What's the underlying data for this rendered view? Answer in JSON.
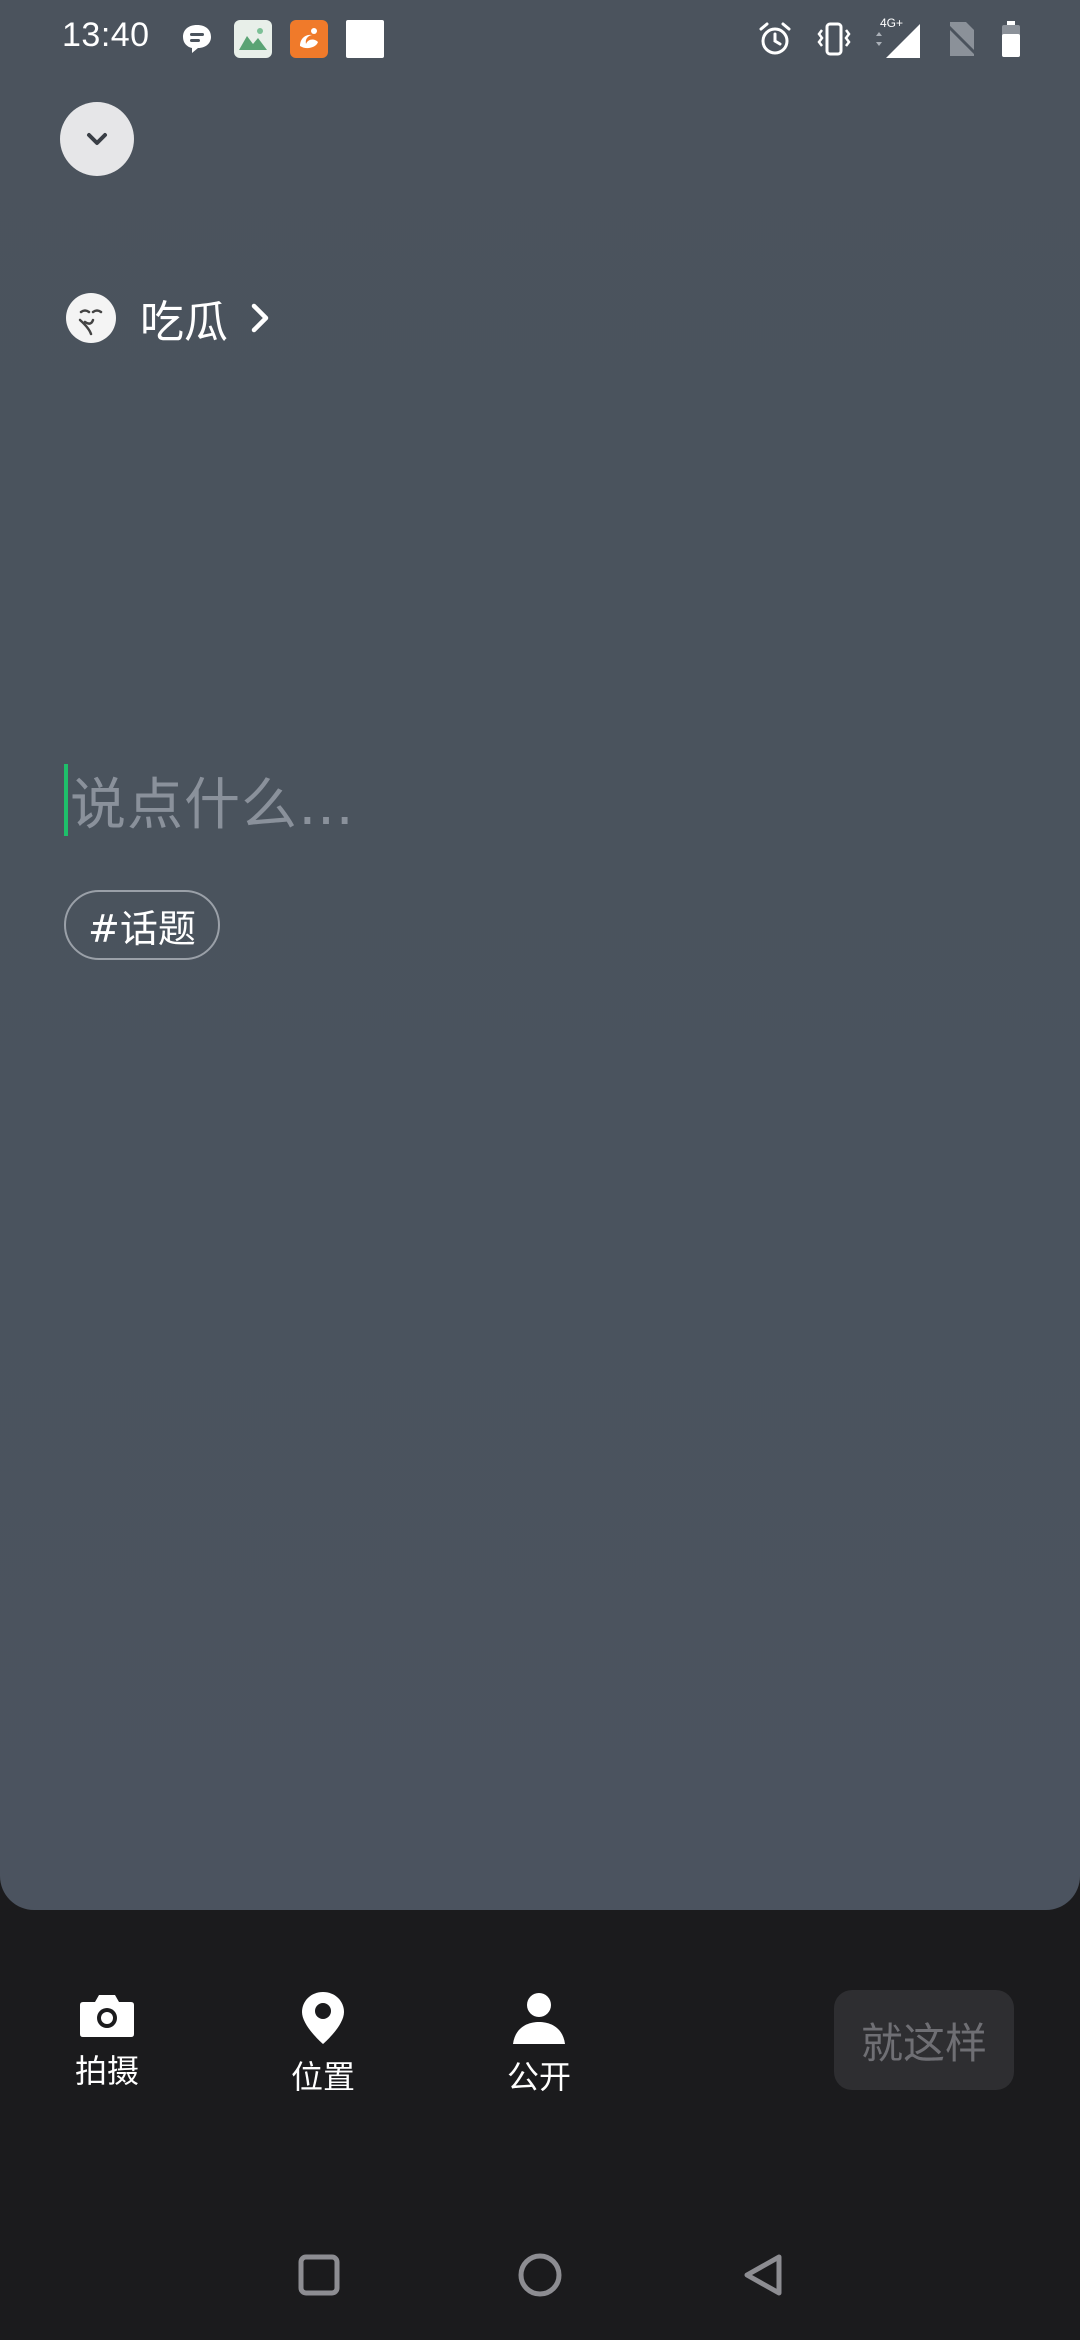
{
  "status_bar": {
    "time": "13:40",
    "network": "4G+",
    "icons_left": [
      "chat-bubble-icon",
      "gallery-app-icon",
      "uc-browser-icon",
      "white-square-icon"
    ],
    "icons_right": [
      "alarm-icon",
      "vibrate-icon",
      "signal-icon",
      "no-sim-icon",
      "battery-icon"
    ]
  },
  "header": {
    "collapse_icon": "chevron-down-icon"
  },
  "mood": {
    "emoji": "melon-eating-emoji",
    "label": "吃瓜"
  },
  "editor": {
    "placeholder": "说点什么…",
    "topic_tag": "#话题",
    "cursor_color": "#1fbf6a"
  },
  "toolbar": {
    "camera_label": "拍摄",
    "location_label": "位置",
    "visibility_label": "公开",
    "submit_label": "就这样"
  },
  "colors": {
    "panel_bg": "#4b535d",
    "page_bg": "#1b1b1d",
    "submit_bg": "#2e2e31",
    "submit_text": "#6f6f74"
  }
}
